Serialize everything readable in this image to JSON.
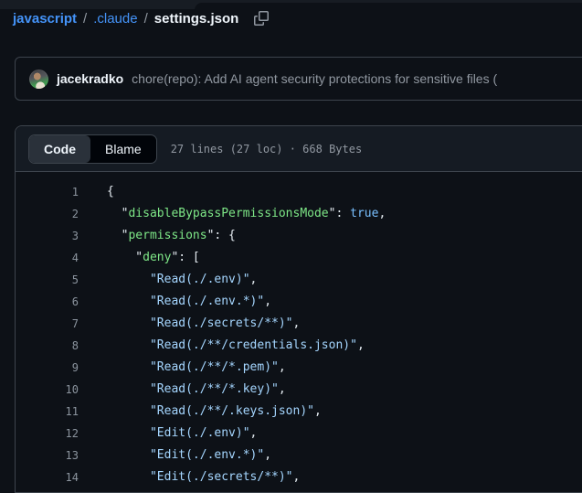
{
  "theme": {
    "accent_link_blue": "#4493f8",
    "page_bg": "#0d1117",
    "panel_header_bg": "#151b23",
    "border": "#3d444d"
  },
  "breadcrumb": {
    "repo": "javascript",
    "separator": "/",
    "folder": ".claude",
    "file": "settings.json",
    "icons": {
      "copy": "copy-icon"
    }
  },
  "commit": {
    "author": "jacekradko",
    "message": "chore(repo): Add AI agent security protections for sensitive files ("
  },
  "file_panel": {
    "tabs": [
      {
        "label": "Code",
        "active": true
      },
      {
        "label": "Blame",
        "active": false
      }
    ],
    "stats": "27 lines (27 loc) · 668 Bytes"
  },
  "code": {
    "colors": {
      "key": "#7ee787",
      "string": "#a5d6ff",
      "boolean": "#79c0ff",
      "punctuation": "#e6edf3",
      "line_number": "#8b949e"
    },
    "lines": [
      {
        "n": 1,
        "tokens": [
          [
            "p",
            "{"
          ]
        ]
      },
      {
        "n": 2,
        "tokens": [
          [
            "p",
            "  \""
          ],
          [
            "k",
            "disableBypassPermissionsMode"
          ],
          [
            "p",
            "\": "
          ],
          [
            "b",
            "true"
          ],
          [
            "p",
            ","
          ]
        ]
      },
      {
        "n": 3,
        "tokens": [
          [
            "p",
            "  \""
          ],
          [
            "k",
            "permissions"
          ],
          [
            "p",
            "\": {"
          ]
        ]
      },
      {
        "n": 4,
        "tokens": [
          [
            "p",
            "    \""
          ],
          [
            "k",
            "deny"
          ],
          [
            "p",
            "\": ["
          ]
        ]
      },
      {
        "n": 5,
        "tokens": [
          [
            "p",
            "      "
          ],
          [
            "s",
            "\"Read(./.env)\""
          ],
          [
            "p",
            ","
          ]
        ]
      },
      {
        "n": 6,
        "tokens": [
          [
            "p",
            "      "
          ],
          [
            "s",
            "\"Read(./.env.*)\""
          ],
          [
            "p",
            ","
          ]
        ]
      },
      {
        "n": 7,
        "tokens": [
          [
            "p",
            "      "
          ],
          [
            "s",
            "\"Read(./secrets/**)\""
          ],
          [
            "p",
            ","
          ]
        ]
      },
      {
        "n": 8,
        "tokens": [
          [
            "p",
            "      "
          ],
          [
            "s",
            "\"Read(./**/credentials.json)\""
          ],
          [
            "p",
            ","
          ]
        ]
      },
      {
        "n": 9,
        "tokens": [
          [
            "p",
            "      "
          ],
          [
            "s",
            "\"Read(./**/*.pem)\""
          ],
          [
            "p",
            ","
          ]
        ]
      },
      {
        "n": 10,
        "tokens": [
          [
            "p",
            "      "
          ],
          [
            "s",
            "\"Read(./**/*.key)\""
          ],
          [
            "p",
            ","
          ]
        ]
      },
      {
        "n": 11,
        "tokens": [
          [
            "p",
            "      "
          ],
          [
            "s",
            "\"Read(./**/.keys.json)\""
          ],
          [
            "p",
            ","
          ]
        ]
      },
      {
        "n": 12,
        "tokens": [
          [
            "p",
            "      "
          ],
          [
            "s",
            "\"Edit(./.env)\""
          ],
          [
            "p",
            ","
          ]
        ]
      },
      {
        "n": 13,
        "tokens": [
          [
            "p",
            "      "
          ],
          [
            "s",
            "\"Edit(./.env.*)\""
          ],
          [
            "p",
            ","
          ]
        ]
      },
      {
        "n": 14,
        "tokens": [
          [
            "p",
            "      "
          ],
          [
            "s",
            "\"Edit(./secrets/**)\""
          ],
          [
            "p",
            ","
          ]
        ]
      }
    ]
  }
}
